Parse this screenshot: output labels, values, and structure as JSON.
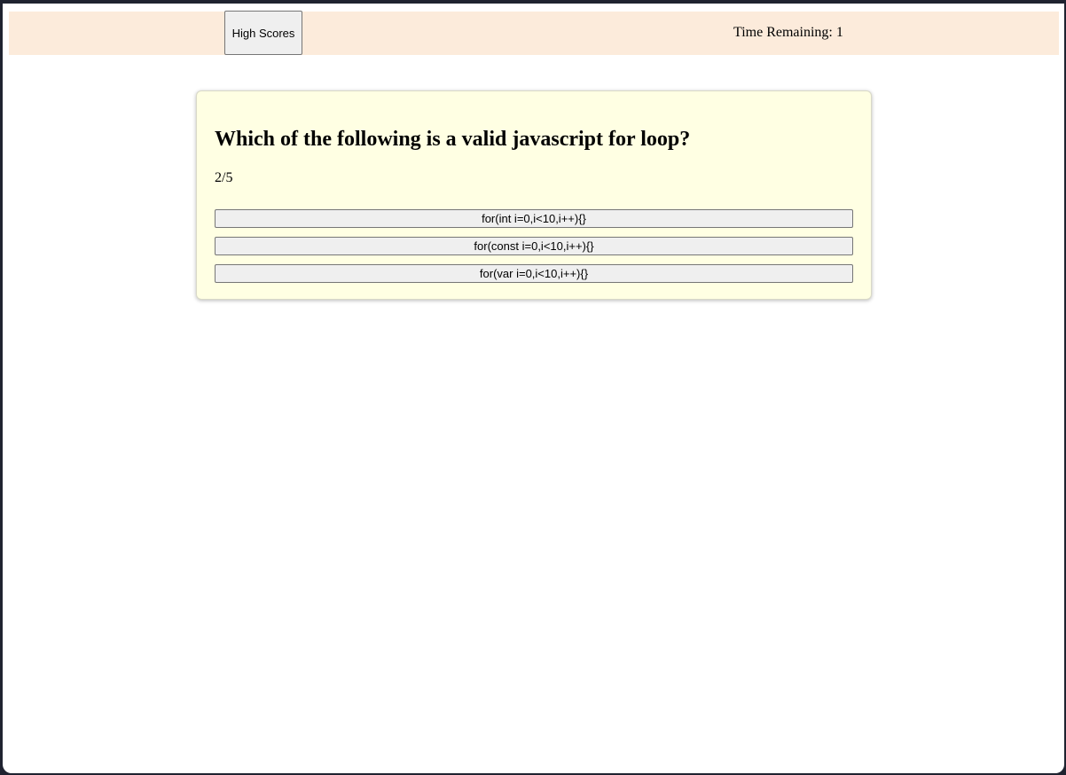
{
  "header": {
    "high_scores_label": "High Scores",
    "timer_label": "Time Remaining:",
    "timer_value": "1"
  },
  "quiz": {
    "question": "Which of the following is a valid javascript for loop?",
    "progress": "2/5",
    "answers": [
      "for(int i=0,i<10,i++){}",
      "for(const i=0,i<10,i++){}",
      "for(var i=0,i<10,i++){}"
    ]
  },
  "colors": {
    "header_background": "#fcebdb",
    "card_background": "#ffffe3",
    "button_background": "#efefef"
  }
}
